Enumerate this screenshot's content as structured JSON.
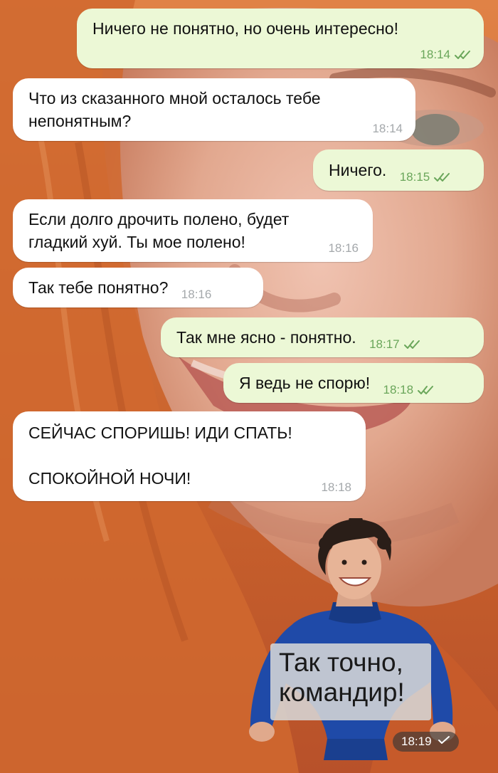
{
  "colors": {
    "outgoing_bubble": "#ecf8d6",
    "incoming_bubble": "#ffffff",
    "outgoing_time": "#6aa65a",
    "incoming_time": "#a4a8ab",
    "wallpaper_hair": "#d8743f",
    "wallpaper_skin": "#e9b7a3"
  },
  "messages": [
    {
      "direction": "out",
      "text": "Ничего не понятно, но очень интересно!",
      "time": "18:14",
      "status": "read"
    },
    {
      "direction": "in",
      "text": "Что из сказанного мной осталось тебе непонятным?",
      "time": "18:14"
    },
    {
      "direction": "out",
      "text": "Ничего.",
      "time": "18:15",
      "status": "read"
    },
    {
      "direction": "in",
      "text": "Если долго дрочить полено, будет гладкий хуй. Ты мое полено!",
      "time": "18:16"
    },
    {
      "direction": "in",
      "text": "Так тебе понятно?",
      "time": "18:16"
    },
    {
      "direction": "out",
      "text": "Так мне ясно - понятно.",
      "time": "18:17",
      "status": "read"
    },
    {
      "direction": "out",
      "text": "Я ведь не спорю!",
      "time": "18:18",
      "status": "read"
    },
    {
      "direction": "in",
      "text_line1": "СЕЙЧАС СПОРИШЬ! ИДИ СПАТЬ!",
      "text_line2": "СПОКОЙНОЙ НОЧИ!",
      "time": "18:18"
    }
  ],
  "sticker": {
    "caption_line1": "Так точно,",
    "caption_line2": "командир!",
    "time": "18:19",
    "status": "sent",
    "status_icon": "single-check-icon"
  },
  "icons": {
    "read_status": "double-check-icon",
    "sent_status": "single-check-icon"
  }
}
